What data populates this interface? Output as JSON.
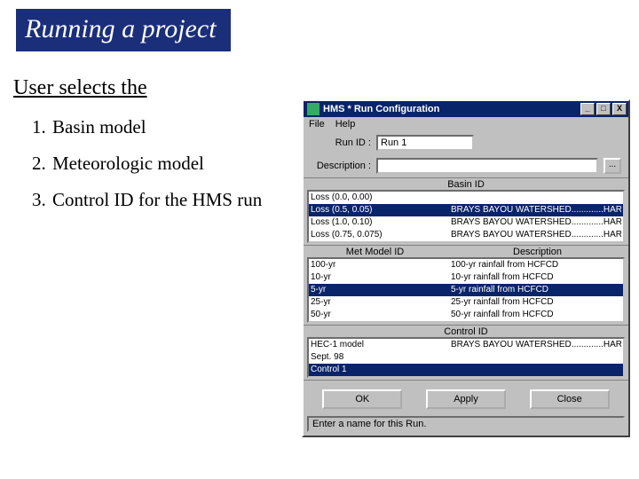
{
  "slide": {
    "title": "Running a project",
    "subhead": "User selects the",
    "items": [
      "Basin model",
      "Meteorologic model",
      "Control ID for the HMS run"
    ]
  },
  "win": {
    "title": "HMS * Run Configuration",
    "menus": [
      "File",
      "Help"
    ],
    "minimize": "_",
    "maximize": "□",
    "close": "X",
    "runid_label": "Run ID :",
    "runid_value": "Run 1",
    "desc_label": "Description :",
    "desc_value": "",
    "ellipsis": "...",
    "basin_head": "Basin ID",
    "basin_rows": [
      {
        "c1": "Loss (0.0, 0.00)",
        "c2": ""
      },
      {
        "c1": "Loss (0.5, 0.05)",
        "c2": "BRAYS BAYOU WATERSHED.............HARRIS COUNTY"
      },
      {
        "c1": "Loss (1.0, 0.10)",
        "c2": "BRAYS BAYOU WATERSHED.............HARRIS COUNTY"
      },
      {
        "c1": "Loss (0.75, 0.075)",
        "c2": "BRAYS BAYOU WATERSHED.............HARRIS COUNTY"
      }
    ],
    "basin_selected": 1,
    "met_head1": "Met Model ID",
    "met_head2": "Description",
    "met_rows": [
      {
        "c1": "100-yr",
        "c2": "100-yr rainfall from HCFCD"
      },
      {
        "c1": "10-yr",
        "c2": "10-yr rainfall from HCFCD"
      },
      {
        "c1": "5-yr",
        "c2": "5-yr rainfall from HCFCD"
      },
      {
        "c1": "25-yr",
        "c2": "25-yr rainfall from HCFCD"
      },
      {
        "c1": "50-yr",
        "c2": "50-yr rainfall from HCFCD"
      }
    ],
    "met_selected": 2,
    "ctrl_head": "Control ID",
    "ctrl_rows": [
      {
        "c1": "HEC-1 model",
        "c2": "BRAYS BAYOU WATERSHED.............HARRIS COUNTY"
      },
      {
        "c1": "Sept. 98",
        "c2": ""
      },
      {
        "c1": "Control 1",
        "c2": ""
      }
    ],
    "ctrl_selected": 2,
    "buttons": {
      "ok": "OK",
      "apply": "Apply",
      "close": "Close"
    },
    "status": "Enter a name for this Run."
  }
}
